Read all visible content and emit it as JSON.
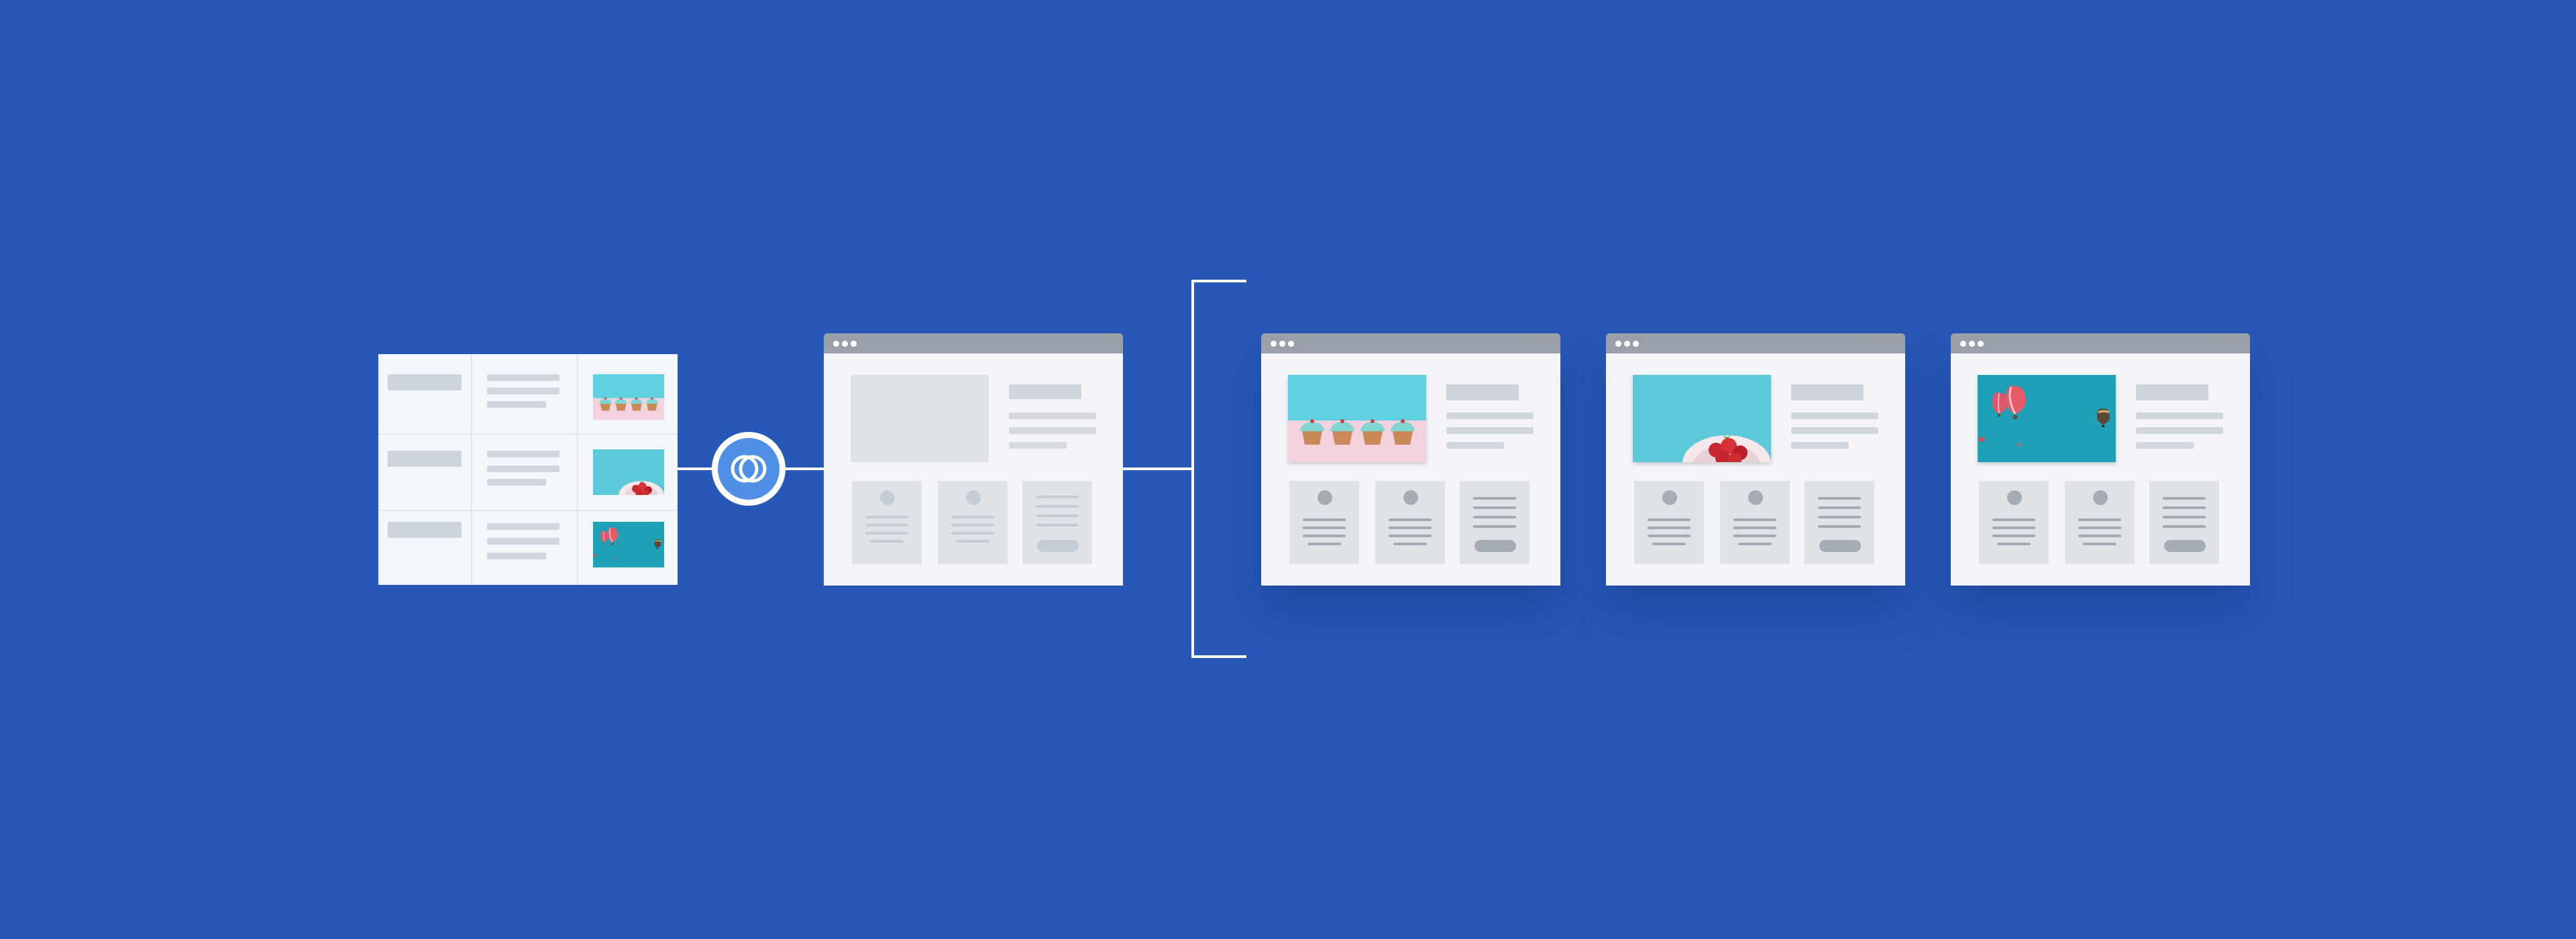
{
  "diagram": {
    "source_table": {
      "rows": [
        {
          "thumbnail": "cupcakes-photo"
        },
        {
          "thumbnail": "strawberries-photo"
        },
        {
          "thumbnail": "hot-air-balloons-photo"
        }
      ]
    },
    "connector_icon": "link-icon",
    "template_window": {
      "hero": "placeholder"
    },
    "generated_pages": [
      {
        "hero": "cupcakes-photo"
      },
      {
        "hero": "strawberries-photo"
      },
      {
        "hero": "hot-air-balloons-photo"
      }
    ]
  },
  "colors": {
    "background": "#2858b7",
    "connector_fill": "#4f8fe5",
    "lines": "#ffffff",
    "window_chrome": "#9aa0a9",
    "window_body": "#f3f5f8",
    "placeholder": "#dfe3e8"
  }
}
